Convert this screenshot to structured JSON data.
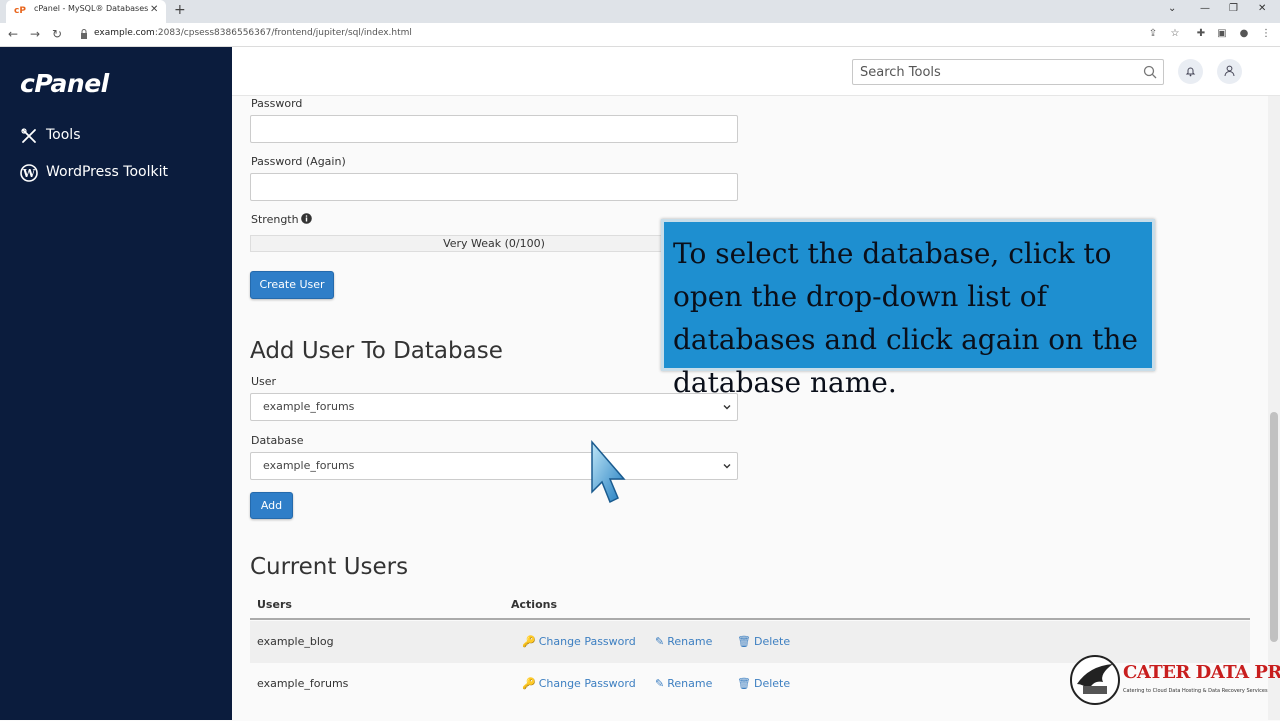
{
  "browser": {
    "tab_title": "cPanel - MySQL® Databases",
    "tab_close": "✕",
    "new_tab": "+",
    "url_host": "example.com",
    "url_rest": ":2083/cpsess8386556367/frontend/jupiter/sql/index.html"
  },
  "sidebar": {
    "logo": "cPanel",
    "items": [
      {
        "label": "Tools",
        "icon": "tools-icon"
      },
      {
        "label": "WordPress Toolkit",
        "icon": "wordpress-icon"
      }
    ]
  },
  "header": {
    "search_placeholder": "Search Tools"
  },
  "form": {
    "password_label": "Password",
    "password_again_label": "Password (Again)",
    "strength_label": "Strength",
    "strength_value": "Very Weak (0/100)",
    "strength_percent": 0,
    "create_user_button": "Create User"
  },
  "add_user_db": {
    "heading": "Add User To Database",
    "user_label": "User",
    "user_selected": "example_forums",
    "database_label": "Database",
    "database_selected": "example_forums",
    "add_button": "Add"
  },
  "current_users": {
    "heading": "Current Users",
    "columns": [
      "Users",
      "Actions"
    ],
    "rows": [
      {
        "user": "example_blog"
      },
      {
        "user": "example_forums"
      }
    ],
    "actions": {
      "change_password": "Change Password",
      "rename": "Rename",
      "delete": "Delete"
    }
  },
  "callout": {
    "text": "To select the database, click to open the drop-down list of databases and click again on the database name."
  },
  "watermark": {
    "title": "CATER DATA PRO",
    "tagline": "Catering to Cloud Data Hosting & Data Recovery Services"
  },
  "colors": {
    "sidebar": "#0b1c3d",
    "primary_button": "#2f7ec8",
    "link": "#3d7fc1",
    "callout": "#1e8fd0"
  }
}
